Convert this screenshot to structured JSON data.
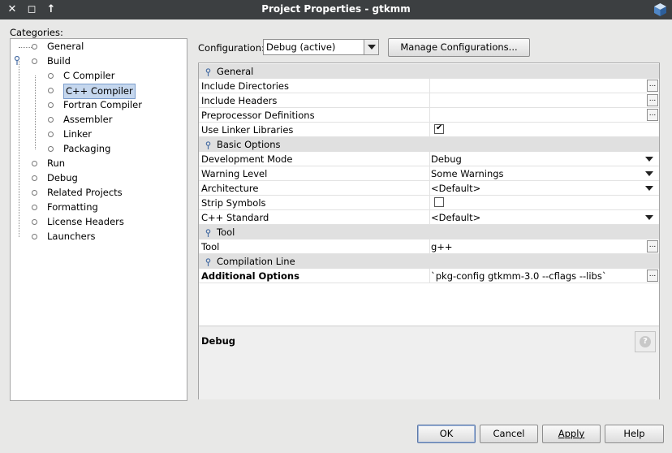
{
  "window": {
    "title": "Project Properties - gtkmm"
  },
  "categories": {
    "label": "Categories:",
    "items": [
      {
        "label": "General"
      },
      {
        "label": "Build"
      },
      {
        "label": "C Compiler"
      },
      {
        "label": "C++ Compiler"
      },
      {
        "label": "Fortran Compiler"
      },
      {
        "label": "Assembler"
      },
      {
        "label": "Linker"
      },
      {
        "label": "Packaging"
      },
      {
        "label": "Run"
      },
      {
        "label": "Debug"
      },
      {
        "label": "Related Projects"
      },
      {
        "label": "Formatting"
      },
      {
        "label": "License Headers"
      },
      {
        "label": "Launchers"
      }
    ]
  },
  "configuration": {
    "label": "Configuration:",
    "value": "Debug (active)",
    "manage_label": "Manage Configurations..."
  },
  "properties": {
    "sections": [
      {
        "title": "General"
      },
      {
        "title": "Basic Options"
      },
      {
        "title": "Tool"
      },
      {
        "title": "Compilation Line"
      }
    ],
    "rows": [
      {
        "name": "Include Directories",
        "value": ""
      },
      {
        "name": "Include Headers",
        "value": ""
      },
      {
        "name": "Preprocessor Definitions",
        "value": ""
      },
      {
        "name": "Use Linker Libraries",
        "value": "✔"
      },
      {
        "name": "Development Mode",
        "value": "Debug"
      },
      {
        "name": "Warning Level",
        "value": "Some Warnings"
      },
      {
        "name": "Architecture",
        "value": "<Default>"
      },
      {
        "name": "Strip Symbols",
        "value": ""
      },
      {
        "name": "C++ Standard",
        "value": "<Default>"
      },
      {
        "name": "Tool",
        "value": "g++"
      },
      {
        "name": "Additional Options",
        "value": "`pkg-config gtkmm-3.0 --cflags --libs`"
      }
    ],
    "ellipsis": "...",
    "checked": true
  },
  "description": {
    "title": "Debug",
    "help_glyph": "?"
  },
  "buttons": {
    "ok": "OK",
    "cancel": "Cancel",
    "apply": "Apply",
    "help": "Help"
  },
  "titlebar_glyphs": {
    "close": "✕",
    "maximize": "◻",
    "up": "↑"
  }
}
